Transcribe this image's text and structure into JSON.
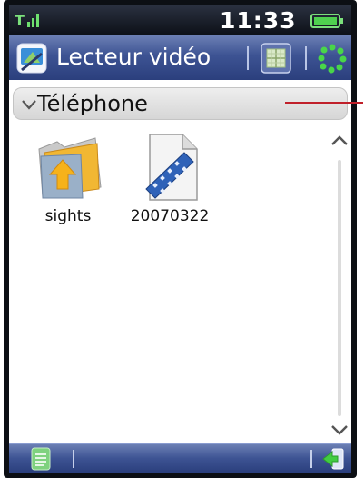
{
  "status_bar": {
    "time": "11:33",
    "signal_label": "Ŷ.ıl"
  },
  "title_bar": {
    "app_title": "Lecteur vidéo"
  },
  "location": {
    "title": "Téléphone"
  },
  "files": [
    {
      "label": "sights",
      "kind": "folder"
    },
    {
      "label": "20070322",
      "kind": "video"
    }
  ],
  "icons": {
    "app": "video-player-icon",
    "grid": "grid-view-icon",
    "settings": "options-dots-icon",
    "expand": "chevron-down-icon",
    "scroll_up": "chevron-up-icon",
    "scroll_down": "chevron-down-icon",
    "docs": "document-icon",
    "exit": "exit-icon"
  },
  "colors": {
    "title_bar": "#3d5393",
    "status_bar": "#0d1118",
    "accent_green": "#37c837",
    "pointer": "#c0202a"
  }
}
